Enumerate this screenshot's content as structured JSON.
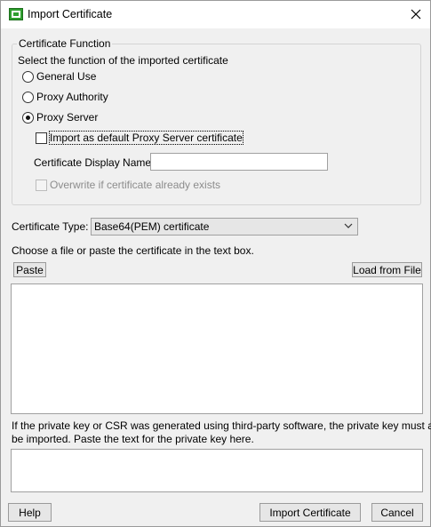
{
  "window": {
    "title": "Import Certificate"
  },
  "function_group": {
    "legend": "Certificate Function",
    "instruction": "Select the function of the imported certificate",
    "options": [
      {
        "label": "General Use",
        "checked": false
      },
      {
        "label": "Proxy Authority",
        "checked": false
      },
      {
        "label": "Proxy Server",
        "checked": true
      }
    ],
    "import_default_label": "Import as default Proxy Server certificate",
    "display_name_label": "Certificate Display Name:",
    "display_name_value": "",
    "overwrite_label": "Overwrite if certificate already exists"
  },
  "cert_type": {
    "label": "Certificate Type:",
    "selected": "Base64(PEM) certificate"
  },
  "file_hint": "Choose a file or paste the certificate in the text box.",
  "paste_button": "Paste",
  "load_button": "Load from File",
  "certificate_text": "",
  "private_key_note_line1": "If the private key or CSR was generated using third-party software, the private key must also",
  "private_key_note_line2": "be imported.  Paste the text for the private key here.",
  "private_key_text": "",
  "footer": {
    "help": "Help",
    "import": "Import Certificate",
    "cancel": "Cancel"
  }
}
